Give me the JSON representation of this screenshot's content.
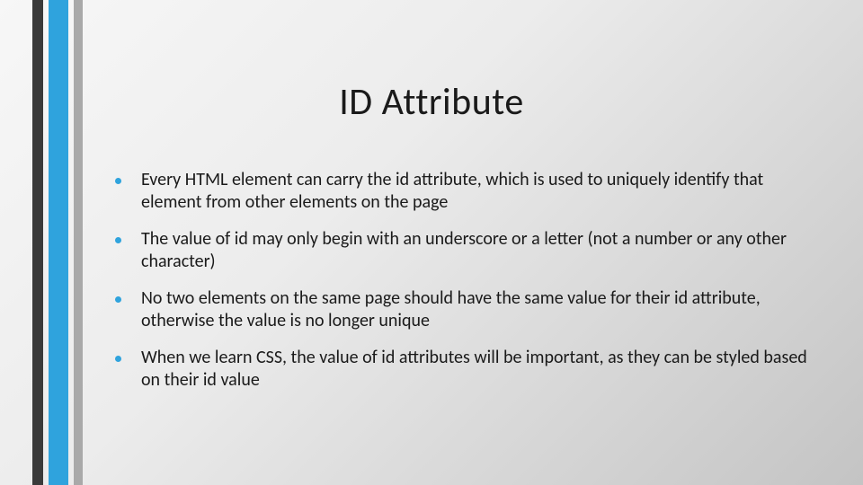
{
  "slide": {
    "title": "ID Attribute",
    "bullets": [
      "Every HTML element can carry the id attribute, which is used to uniquely identify that element from other elements on the page",
      "The value of id may only begin with an underscore or a letter (not a number or any other character)",
      "No two elements on the same page should have the same value for their id attribute, otherwise the value is no longer unique",
      "When we learn CSS, the value of id attributes will be important, as they can be styled based on their id value"
    ]
  }
}
